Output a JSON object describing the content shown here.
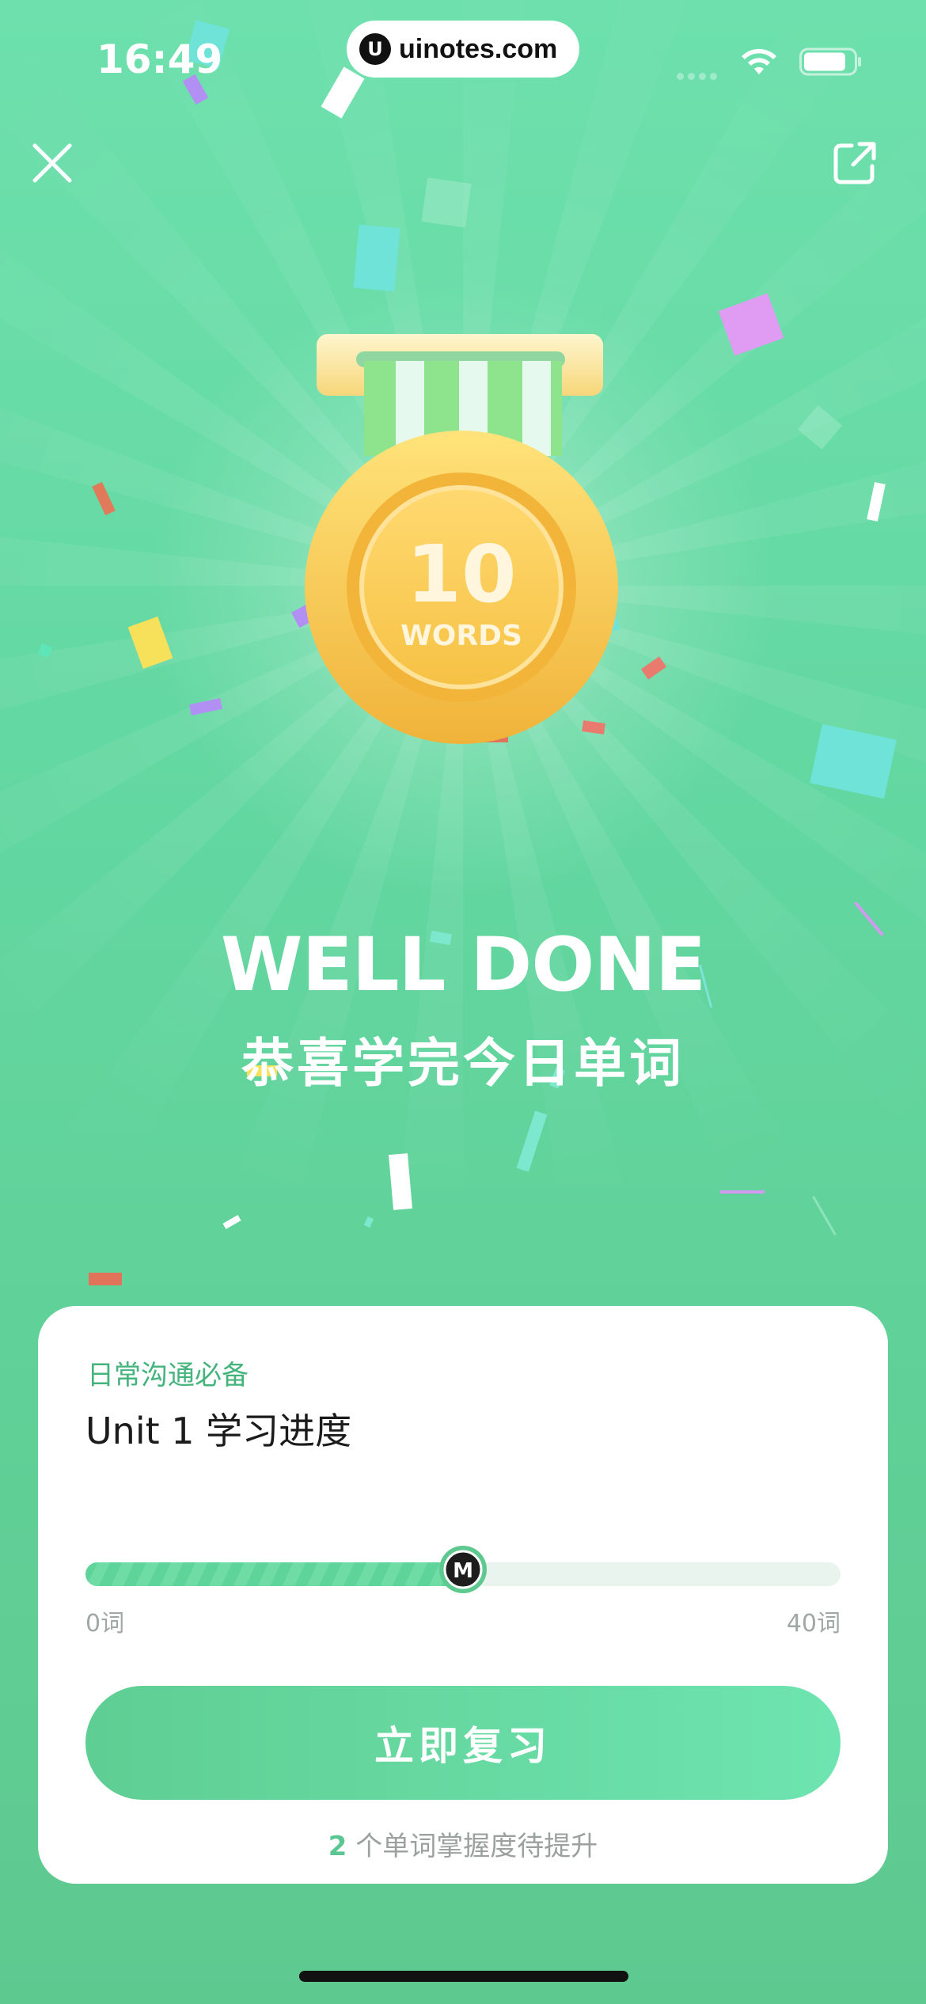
{
  "status_bar": {
    "time": "16:49",
    "url": "uinotes.com",
    "url_logo": "U"
  },
  "header": {
    "close_icon": "close-icon",
    "share_icon": "share-icon"
  },
  "medal": {
    "number": "10",
    "label": "WORDS"
  },
  "celebration": {
    "title": "WELL DONE",
    "subtitle": "恭喜学完今日单词"
  },
  "card": {
    "subtitle": "日常沟通必备",
    "title": "Unit 1 学习进度",
    "progress": {
      "value": 20,
      "max": 40,
      "min_label": "0词",
      "max_label": "40词",
      "thumb_logo": "M"
    },
    "button_label": "立即复习",
    "footnote_count": "2",
    "footnote_text": " 个单词掌握度待提升"
  },
  "colors": {
    "accent": "#5ec98f",
    "medal_gold": "#f2b53a",
    "subtitle_green": "#44b37c"
  }
}
